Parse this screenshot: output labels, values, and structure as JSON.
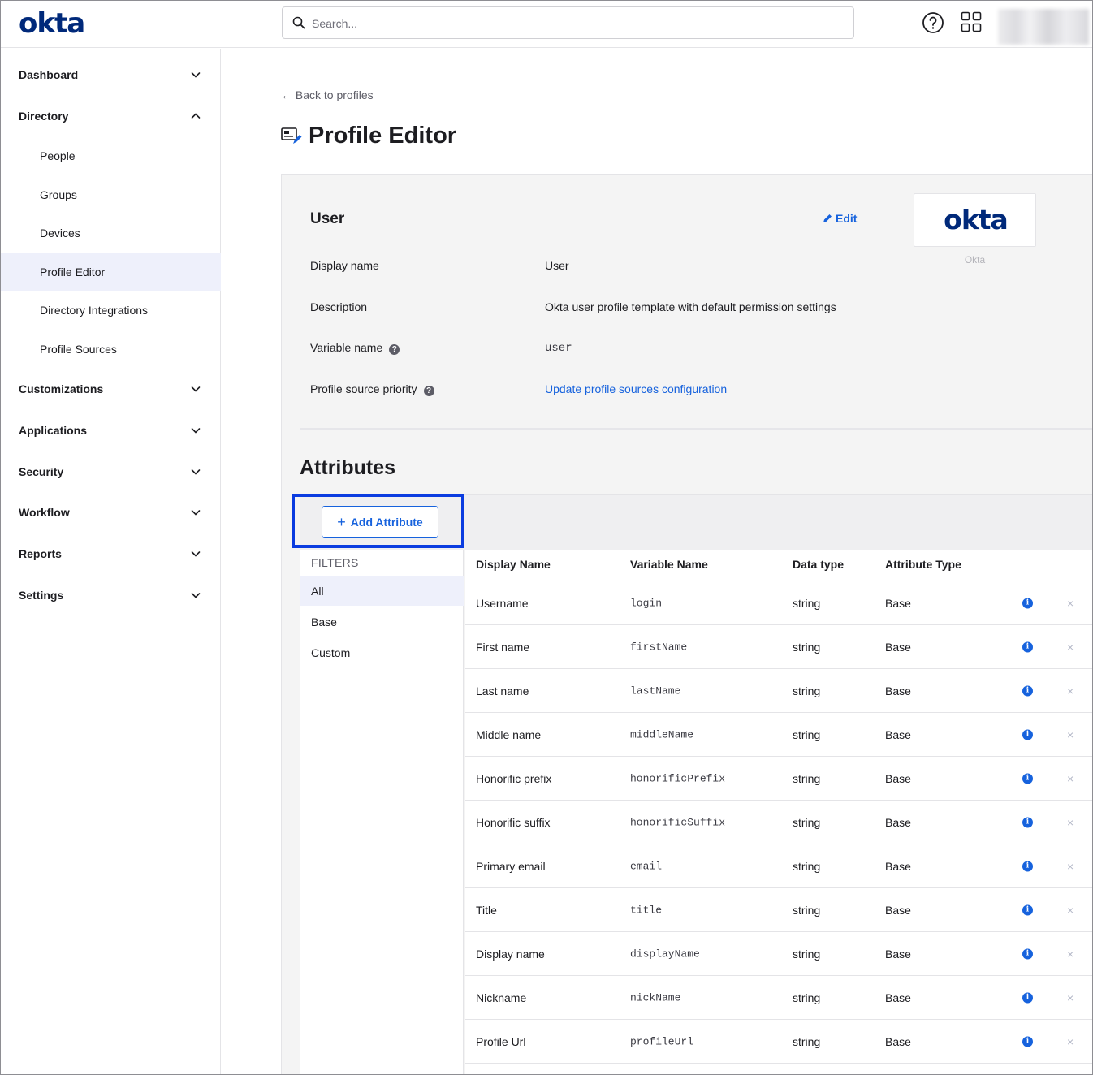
{
  "header": {
    "logo_text": "okta",
    "search_placeholder": "Search...",
    "help_icon": "question-circle-icon",
    "apps_icon": "app-grid-icon"
  },
  "sidebar": {
    "top_items": [
      {
        "label": "Dashboard",
        "expanded": false
      },
      {
        "label": "Directory",
        "expanded": true
      },
      {
        "label": "Customizations",
        "expanded": false
      },
      {
        "label": "Applications",
        "expanded": false
      },
      {
        "label": "Security",
        "expanded": false
      },
      {
        "label": "Workflow",
        "expanded": false
      },
      {
        "label": "Reports",
        "expanded": false
      },
      {
        "label": "Settings",
        "expanded": false
      }
    ],
    "directory_items": [
      {
        "label": "People"
      },
      {
        "label": "Groups"
      },
      {
        "label": "Devices"
      },
      {
        "label": "Profile Editor",
        "active": true
      },
      {
        "label": "Directory Integrations"
      },
      {
        "label": "Profile Sources"
      }
    ]
  },
  "main": {
    "back_link": "← Back to profiles",
    "title": "Profile Editor",
    "user_section": {
      "title": "User",
      "edit_label": "Edit",
      "properties": [
        {
          "label": "Display name",
          "value": "User"
        },
        {
          "label": "Description",
          "value": "Okta user profile template with default permission settings"
        },
        {
          "label": "Variable name",
          "value": "user"
        },
        {
          "label": "Profile source priority",
          "value": "Update profile sources configuration"
        }
      ],
      "app_logo_text": "okta",
      "app_logo_caption": "Okta"
    },
    "attributes": {
      "title": "Attributes",
      "add_button": "Add Attribute",
      "filters_heading": "FILTERS",
      "filters": [
        "All",
        "Base",
        "Custom"
      ],
      "columns": [
        "Display Name",
        "Variable Name",
        "Data type",
        "Attribute Type"
      ],
      "rows": [
        {
          "display": "Username",
          "variable": "login",
          "type": "string",
          "attr_type": "Base"
        },
        {
          "display": "First name",
          "variable": "firstName",
          "type": "string",
          "attr_type": "Base"
        },
        {
          "display": "Last name",
          "variable": "lastName",
          "type": "string",
          "attr_type": "Base"
        },
        {
          "display": "Middle name",
          "variable": "middleName",
          "type": "string",
          "attr_type": "Base"
        },
        {
          "display": "Honorific prefix",
          "variable": "honorificPrefix",
          "type": "string",
          "attr_type": "Base"
        },
        {
          "display": "Honorific suffix",
          "variable": "honorificSuffix",
          "type": "string",
          "attr_type": "Base"
        },
        {
          "display": "Primary email",
          "variable": "email",
          "type": "string",
          "attr_type": "Base"
        },
        {
          "display": "Title",
          "variable": "title",
          "type": "string",
          "attr_type": "Base"
        },
        {
          "display": "Display name",
          "variable": "displayName",
          "type": "string",
          "attr_type": "Base"
        },
        {
          "display": "Nickname",
          "variable": "nickName",
          "type": "string",
          "attr_type": "Base"
        },
        {
          "display": "Profile Url",
          "variable": "profileUrl",
          "type": "string",
          "attr_type": "Base"
        }
      ]
    }
  },
  "colors": {
    "brand": "#00297a",
    "link": "#1662dd",
    "highlight": "#0b3ce0",
    "active_bg": "#eef0fb"
  }
}
